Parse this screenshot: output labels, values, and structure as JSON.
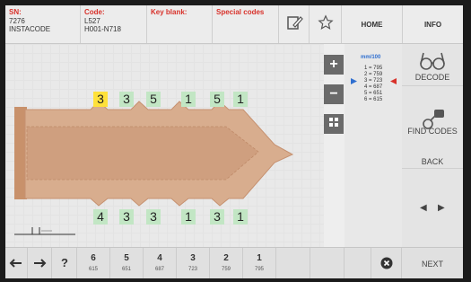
{
  "header": {
    "sn_label": "SN:",
    "sn_value1": "7276",
    "sn_value2": "INSTACODE",
    "code_label": "Code:",
    "code_value1": "L527",
    "code_value2": "H001-N718",
    "keyblank_label": "Key blank:",
    "special_label": "Special codes",
    "home_label": "HOME",
    "info_label": "INFO"
  },
  "cuts_top": [
    "3",
    "3",
    "5",
    "1",
    "5",
    "1"
  ],
  "cuts_bottom": [
    "4",
    "3",
    "3",
    "1",
    "3",
    "1"
  ],
  "selected_cut": 0,
  "controls": {
    "plus": "+",
    "minus": "−"
  },
  "depths": {
    "unit": "mm/100",
    "rows": [
      "1 = 795",
      "2 = 759",
      "3 = 723",
      "4 = 687",
      "5 = 651",
      "6 = 615"
    ],
    "selected_row": 2
  },
  "menu": {
    "decode": "DECODE",
    "find_codes": "FIND CODES",
    "back": "BACK",
    "next": "NEXT"
  },
  "footer_cuts": [
    {
      "n": "6",
      "v": "615"
    },
    {
      "n": "5",
      "v": "651"
    },
    {
      "n": "4",
      "v": "687"
    },
    {
      "n": "3",
      "v": "723"
    },
    {
      "n": "2",
      "v": "759"
    },
    {
      "n": "1",
      "v": "795"
    }
  ],
  "footer": {
    "help": "?"
  },
  "colors": {
    "accent_red": "#d8312a",
    "key_fill": "#d8ad8e",
    "cut_chip": "#c2e6c4",
    "cut_selected": "#ffe13a",
    "indicator_blue": "#2f6fd0"
  },
  "icons": [
    "edit-icon",
    "star-icon",
    "plus-icon",
    "minus-icon",
    "expand-icon",
    "glasses-icon",
    "key-icon",
    "arrow-left-icon",
    "arrow-right-icon",
    "close-circle-icon"
  ]
}
